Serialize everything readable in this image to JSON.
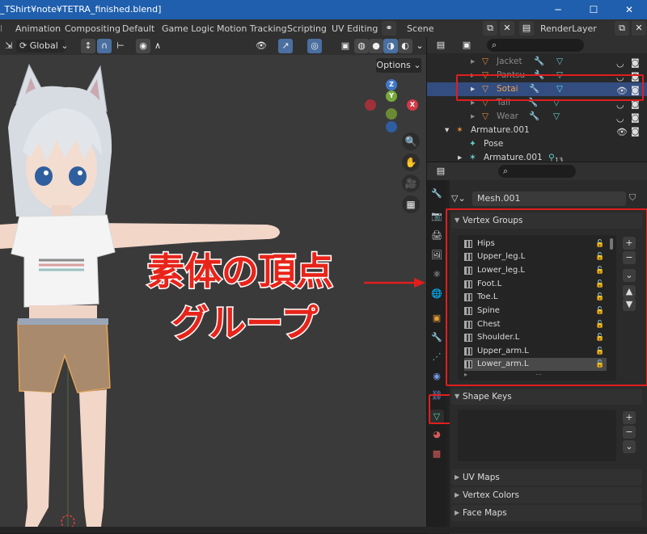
{
  "window": {
    "title": "_TShirt¥note¥TETRA_finished.blend]",
    "min_glyph": "─",
    "max_glyph": "☐",
    "close_glyph": "✕"
  },
  "menubar": {
    "items": [
      "Animation",
      "Compositing",
      "Default",
      "Game Logic",
      "Motion Tracking",
      "Scripting",
      "UV Editing"
    ],
    "scene_label": "Scene",
    "renderlayer_label": "RenderLayer"
  },
  "viewport": {
    "transform_orientation": "Global",
    "options_label": "Options",
    "gizmo": {
      "z": "Z",
      "y": "Y",
      "x": "X"
    },
    "annotation_line1": "素体の頂点",
    "annotation_line2": "グループ"
  },
  "outliner": {
    "rows": [
      {
        "name": "Jacket",
        "dim": true,
        "selected": false
      },
      {
        "name": "Pantsu",
        "dim": true,
        "selected": false
      },
      {
        "name": "Sotai",
        "dim": false,
        "selected": true
      },
      {
        "name": "Tail",
        "dim": true,
        "selected": false
      },
      {
        "name": "Wear",
        "dim": true,
        "selected": false
      },
      {
        "name": "Armature.001",
        "dim": false,
        "selected": false
      },
      {
        "name": "Pose",
        "dim": false,
        "selected": false
      },
      {
        "name": "Armature.001",
        "dim": false,
        "selected": false
      }
    ],
    "armature_child_count": "13"
  },
  "properties": {
    "mesh_name": "Mesh.001",
    "vertex_groups_title": "Vertex Groups",
    "vertex_groups": [
      "Hips",
      "Upper_leg.L",
      "Lower_leg.L",
      "Foot.L",
      "Toe.L",
      "Spine",
      "Chest",
      "Shoulder.L",
      "Upper_arm.L",
      "Lower_arm.L"
    ],
    "selected_group": "Lower_arm.L",
    "shape_keys_title": "Shape Keys",
    "uv_maps_title": "UV Maps",
    "vertex_colors_title": "Vertex Colors",
    "face_maps_title": "Face Maps"
  },
  "colors": {
    "annotation_red": "#e21d1d",
    "selection_blue": "#334d80",
    "titlebar_blue": "#1f5fae"
  }
}
